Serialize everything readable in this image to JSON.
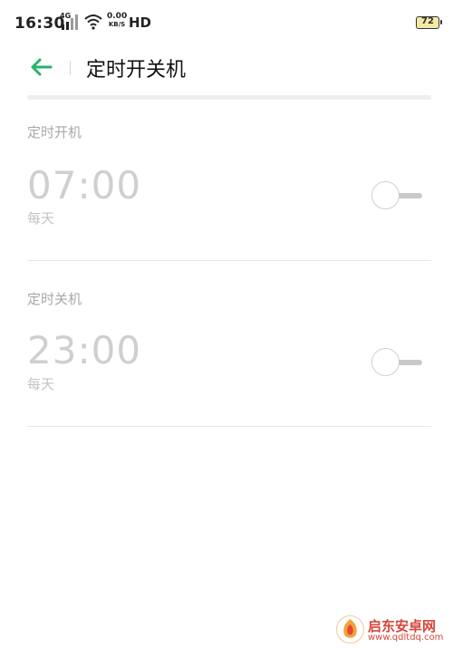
{
  "status_bar": {
    "time": "16:30",
    "network": "4G",
    "speed_value": "0.00",
    "speed_unit": "KB/S",
    "hd": "HD",
    "battery": "72"
  },
  "header": {
    "title": "定时开关机",
    "accent_color": "#27b36b"
  },
  "schedules": [
    {
      "label": "定时开机",
      "time": "07:00",
      "repeat": "每天",
      "enabled": false
    },
    {
      "label": "定时关机",
      "time": "23:00",
      "repeat": "每天",
      "enabled": false
    }
  ],
  "watermark": {
    "name": "启东安卓网",
    "url": "www.qdltdq.com"
  }
}
